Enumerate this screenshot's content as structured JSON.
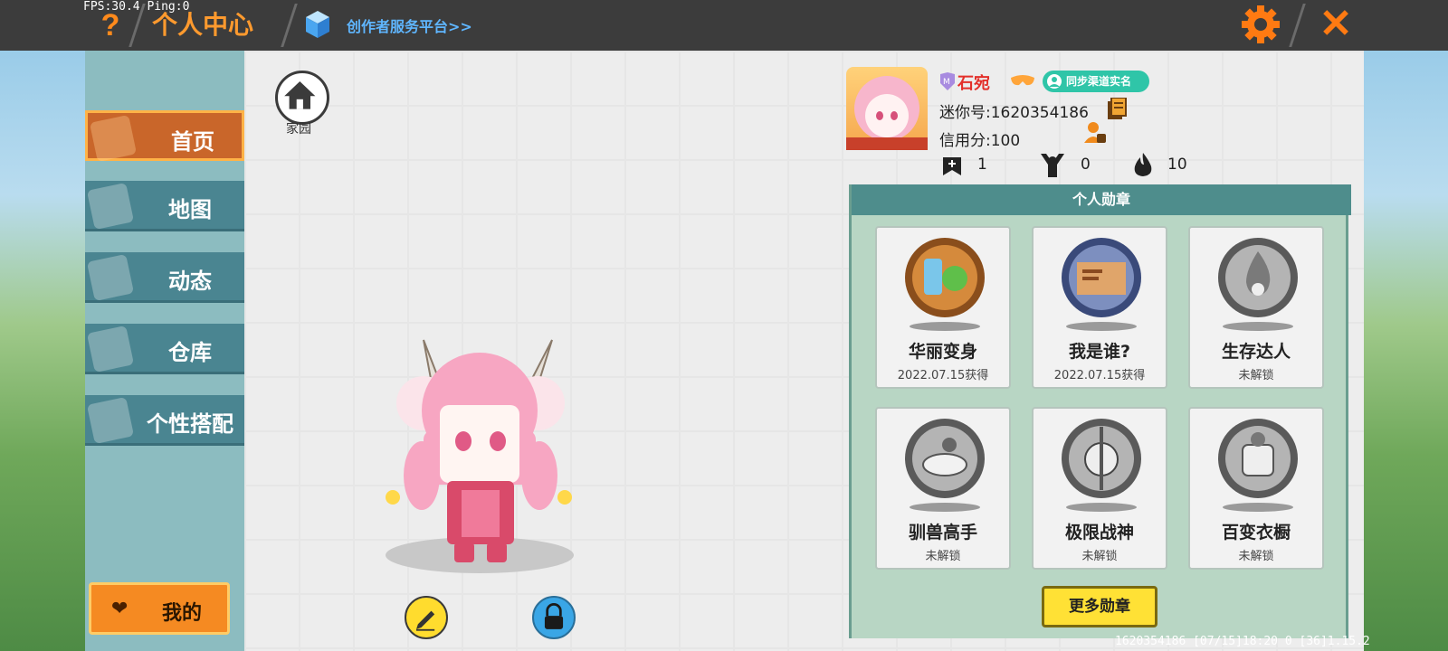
{
  "topbar": {
    "fps_text": "FPS:30.4 Ping:0",
    "help_icon": "question-mark-icon",
    "title": "个人中心",
    "creator_link": "创作者服务平台>>",
    "settings_icon": "gear-icon",
    "close_icon": "close-icon"
  },
  "sidebar": {
    "items": [
      {
        "label": "首页",
        "icon": "home-icon",
        "active": true
      },
      {
        "label": "地图",
        "icon": "map-icon",
        "active": false
      },
      {
        "label": "动态",
        "icon": "bell-icon",
        "active": false
      },
      {
        "label": "仓库",
        "icon": "warehouse-icon",
        "active": false
      },
      {
        "label": "个性搭配",
        "icon": "outfit-icon",
        "active": false
      }
    ],
    "my_button": "我的"
  },
  "home": {
    "label": "家园"
  },
  "profile": {
    "name": "石宛",
    "sync_badge": "同步渠道实名",
    "mini_id": "迷你号:1620354186",
    "credit": "信用分:100",
    "stats": [
      {
        "icon": "add-friend-icon",
        "value": "1"
      },
      {
        "icon": "fans-icon",
        "value": "0"
      },
      {
        "icon": "fire-icon",
        "value": "10"
      }
    ]
  },
  "badges": {
    "header": "个人勋章",
    "items": [
      {
        "name": "华丽变身",
        "status": "2022.07.15获得",
        "unlocked": true
      },
      {
        "name": "我是谁?",
        "status": "2022.07.15获得",
        "unlocked": true
      },
      {
        "name": "生存达人",
        "status": "未解锁",
        "unlocked": false
      },
      {
        "name": "驯兽高手",
        "status": "未解锁",
        "unlocked": false
      },
      {
        "name": "极限战神",
        "status": "未解锁",
        "unlocked": false
      },
      {
        "name": "百变衣橱",
        "status": "未解锁",
        "unlocked": false
      }
    ],
    "more_button": "更多勋章"
  },
  "footer": {
    "info": "1620354186 [07/15]18:20 0 [36]1.15.2"
  },
  "colors": {
    "accent_orange": "#f58a22",
    "nav_teal": "#4a8591",
    "badge_header": "#4e8d8c"
  }
}
